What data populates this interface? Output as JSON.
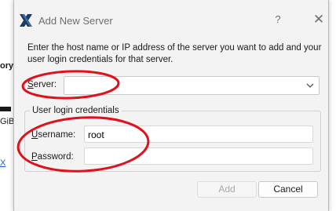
{
  "background_app": {
    "fragment_bold": "ory",
    "fragment_size": "GiB",
    "fragment_link": "X"
  },
  "dialog": {
    "title": "Add New Server",
    "help_label": "?",
    "close_label": "✕",
    "description": "Enter the host name or IP address of the server you want to add and your user login credentials for that server.",
    "server": {
      "label_prefix": "S",
      "label_rest": "erver:",
      "value": ""
    },
    "credentials_group": {
      "title": "User login credentials",
      "username_label_prefix": "U",
      "username_label_rest": "sername:",
      "username_value": "root",
      "password_label_prefix": "P",
      "password_label_rest": "assword:",
      "password_value": ""
    },
    "buttons": {
      "add": "Add",
      "cancel": "Cancel"
    }
  },
  "colors": {
    "annotation": "#e0101c",
    "dialog_bg": "#f3f3f3",
    "disabled_text": "#a8a8a8",
    "link": "#1f5fbf"
  },
  "icons": {
    "app": "x-logo-icon",
    "dropdown": "chevron-down-icon"
  }
}
